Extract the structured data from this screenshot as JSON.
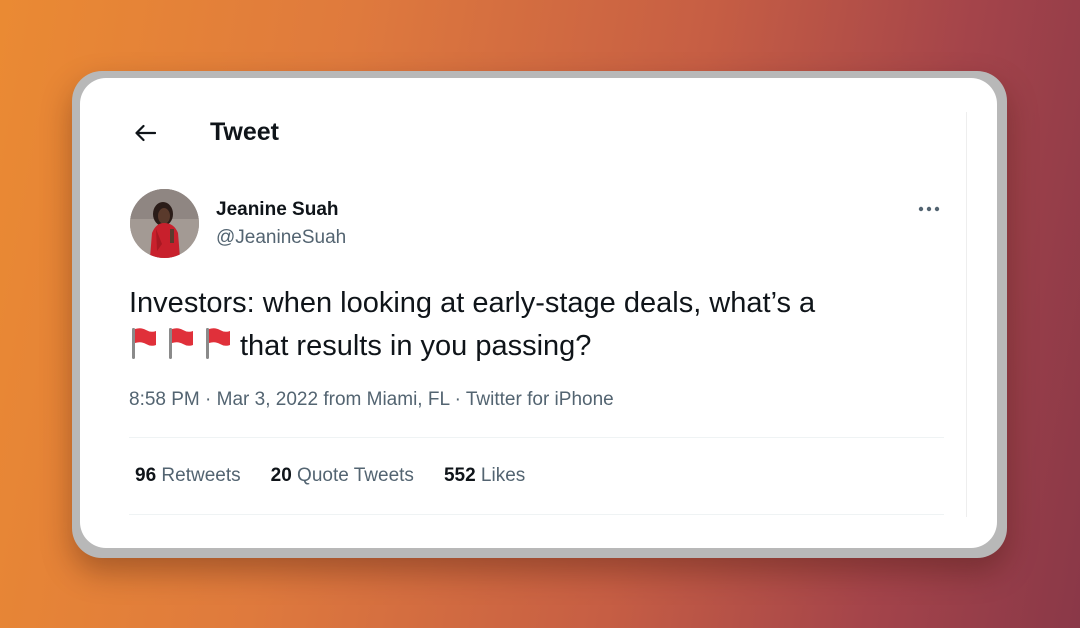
{
  "header": {
    "title": "Tweet",
    "back_icon": "arrow-left-icon"
  },
  "author": {
    "name": "Jeanine Suah",
    "handle": "@JeanineSuah",
    "avatar": "profile-photo"
  },
  "tweet": {
    "line1": "Investors: when looking at early-stage deals, what’s a",
    "flags": [
      "red-flag-emoji",
      "red-flag-emoji",
      "red-flag-emoji"
    ],
    "line2": "that results in you passing?"
  },
  "meta": {
    "time": "8:58 PM",
    "date": "Mar 3, 2022",
    "from": "from",
    "location": "Miami, FL",
    "source": "Twitter for iPhone"
  },
  "stats": [
    {
      "count": "96",
      "label": "Retweets"
    },
    {
      "count": "20",
      "label": "Quote Tweets"
    },
    {
      "count": "552",
      "label": "Likes"
    }
  ],
  "colors": {
    "text_primary": "#0f1419",
    "text_secondary": "#536471",
    "flag_red": "#e0303a",
    "background_start": "#ea8a33",
    "background_end": "#8a3848"
  }
}
